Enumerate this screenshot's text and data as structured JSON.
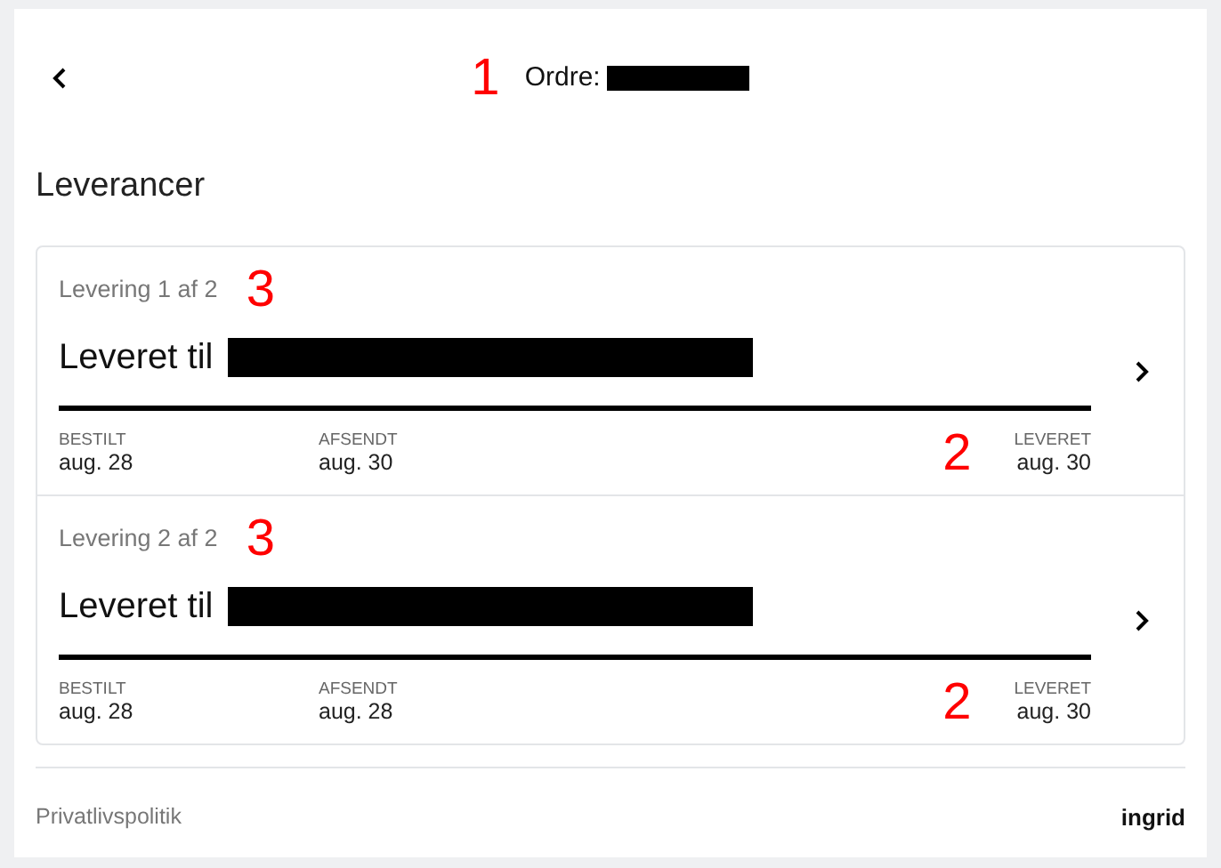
{
  "header": {
    "annotation": "1",
    "title": "Ordre:"
  },
  "section_title": "Leverancer",
  "deliveries": [
    {
      "label": "Levering 1 af 2",
      "annotation": "3",
      "recipient": "Leveret til",
      "steps": [
        {
          "label": "BESTILT",
          "date": "aug. 28"
        },
        {
          "label": "AFSENDT",
          "date": "aug. 30"
        },
        {
          "label": "LEVERET",
          "date": "aug. 30"
        }
      ],
      "steps_annotation": "2"
    },
    {
      "label": "Levering 2 af 2",
      "annotation": "3",
      "recipient": "Leveret til",
      "steps": [
        {
          "label": "BESTILT",
          "date": "aug. 28"
        },
        {
          "label": "AFSENDT",
          "date": "aug. 28"
        },
        {
          "label": "LEVERET",
          "date": "aug. 30"
        }
      ],
      "steps_annotation": "2"
    }
  ],
  "footer": {
    "link": "Privatlivspolitik",
    "logo": "ingrid"
  }
}
